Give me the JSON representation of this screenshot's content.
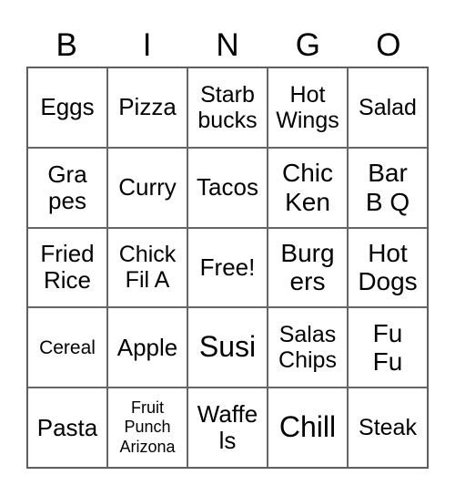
{
  "header": [
    "B",
    "I",
    "N",
    "G",
    "O"
  ],
  "cells": [
    [
      "Eggs",
      "Pizza",
      "Starb\nbucks",
      "Hot\nWings",
      "Salad"
    ],
    [
      "Gra\npes",
      "Curry",
      "Tacos",
      "Chic\nKen",
      "Bar\nB Q"
    ],
    [
      "Fried\nRice",
      "Chick\nFil A",
      "Free!",
      "Burg\ners",
      "Hot\nDogs"
    ],
    [
      "Cereal",
      "Apple",
      "Susi",
      "Salas\nChips",
      "Fu\nFu"
    ],
    [
      "Pasta",
      "Fruit\nPunch\nArizona",
      "Waffe\nls",
      "Chill",
      "Steak"
    ]
  ]
}
